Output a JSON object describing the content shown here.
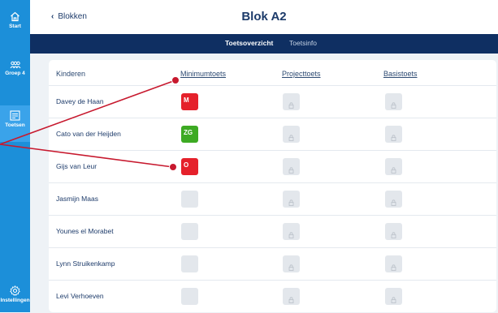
{
  "sidebar": {
    "items": [
      {
        "label": "Start",
        "icon": "home-icon"
      },
      {
        "label": "Groep 4",
        "icon": "group-icon"
      },
      {
        "label": "Toetsen",
        "icon": "tests-icon",
        "active": true
      }
    ],
    "settings": {
      "label": "Instellingen",
      "icon": "gear-icon"
    }
  },
  "header": {
    "back_label": "Blokken",
    "title": "Blok A2"
  },
  "tabs": [
    {
      "label": "Toetsoverzicht",
      "active": true
    },
    {
      "label": "Toetsinfo",
      "active": false
    }
  ],
  "table": {
    "columns": [
      "Kinderen",
      "Minimumtoets",
      "Projecttoets",
      "Basistoets"
    ],
    "rows": [
      {
        "name": "Davey de Haan",
        "minimum": {
          "value": "M",
          "color": "#e5212b"
        }
      },
      {
        "name": "Cato van der Heijden",
        "minimum": {
          "value": "ZG",
          "color": "#3daa23"
        }
      },
      {
        "name": "Gijs van Leur",
        "minimum": {
          "value": "O",
          "color": "#e5212b"
        }
      },
      {
        "name": "Jasmijn Maas",
        "minimum": {
          "value": ""
        }
      },
      {
        "name": "Younes el Morabet",
        "minimum": {
          "value": ""
        }
      },
      {
        "name": "Lynn Struikenkamp",
        "minimum": {
          "value": ""
        }
      },
      {
        "name": "Levi Verhoeven",
        "minimum": {
          "value": ""
        }
      }
    ]
  },
  "colors": {
    "sidebar": "#1c8fd9",
    "tabbar": "#0f2f62",
    "annotation": "#c7192e"
  }
}
